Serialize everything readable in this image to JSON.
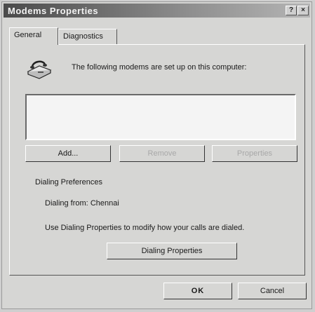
{
  "window": {
    "title": "Modems Properties",
    "help_button": "?",
    "close_button": "×"
  },
  "tabs": [
    {
      "label": "General",
      "active": true
    },
    {
      "label": "Diagnostics",
      "active": false
    }
  ],
  "general": {
    "intro_text": "The following modems are set up on this computer:",
    "modem_list": [],
    "buttons": {
      "add": "Add...",
      "remove": "Remove",
      "properties": "Properties"
    },
    "dialing_preferences_label": "Dialing Preferences",
    "dialing_from_label": "Dialing from:",
    "dialing_from_value": "Chennai",
    "hint": "Use Dialing Properties to modify how your calls are dialed.",
    "dialing_properties_button": "Dialing Properties"
  },
  "footer": {
    "ok": "OK",
    "cancel": "Cancel"
  }
}
